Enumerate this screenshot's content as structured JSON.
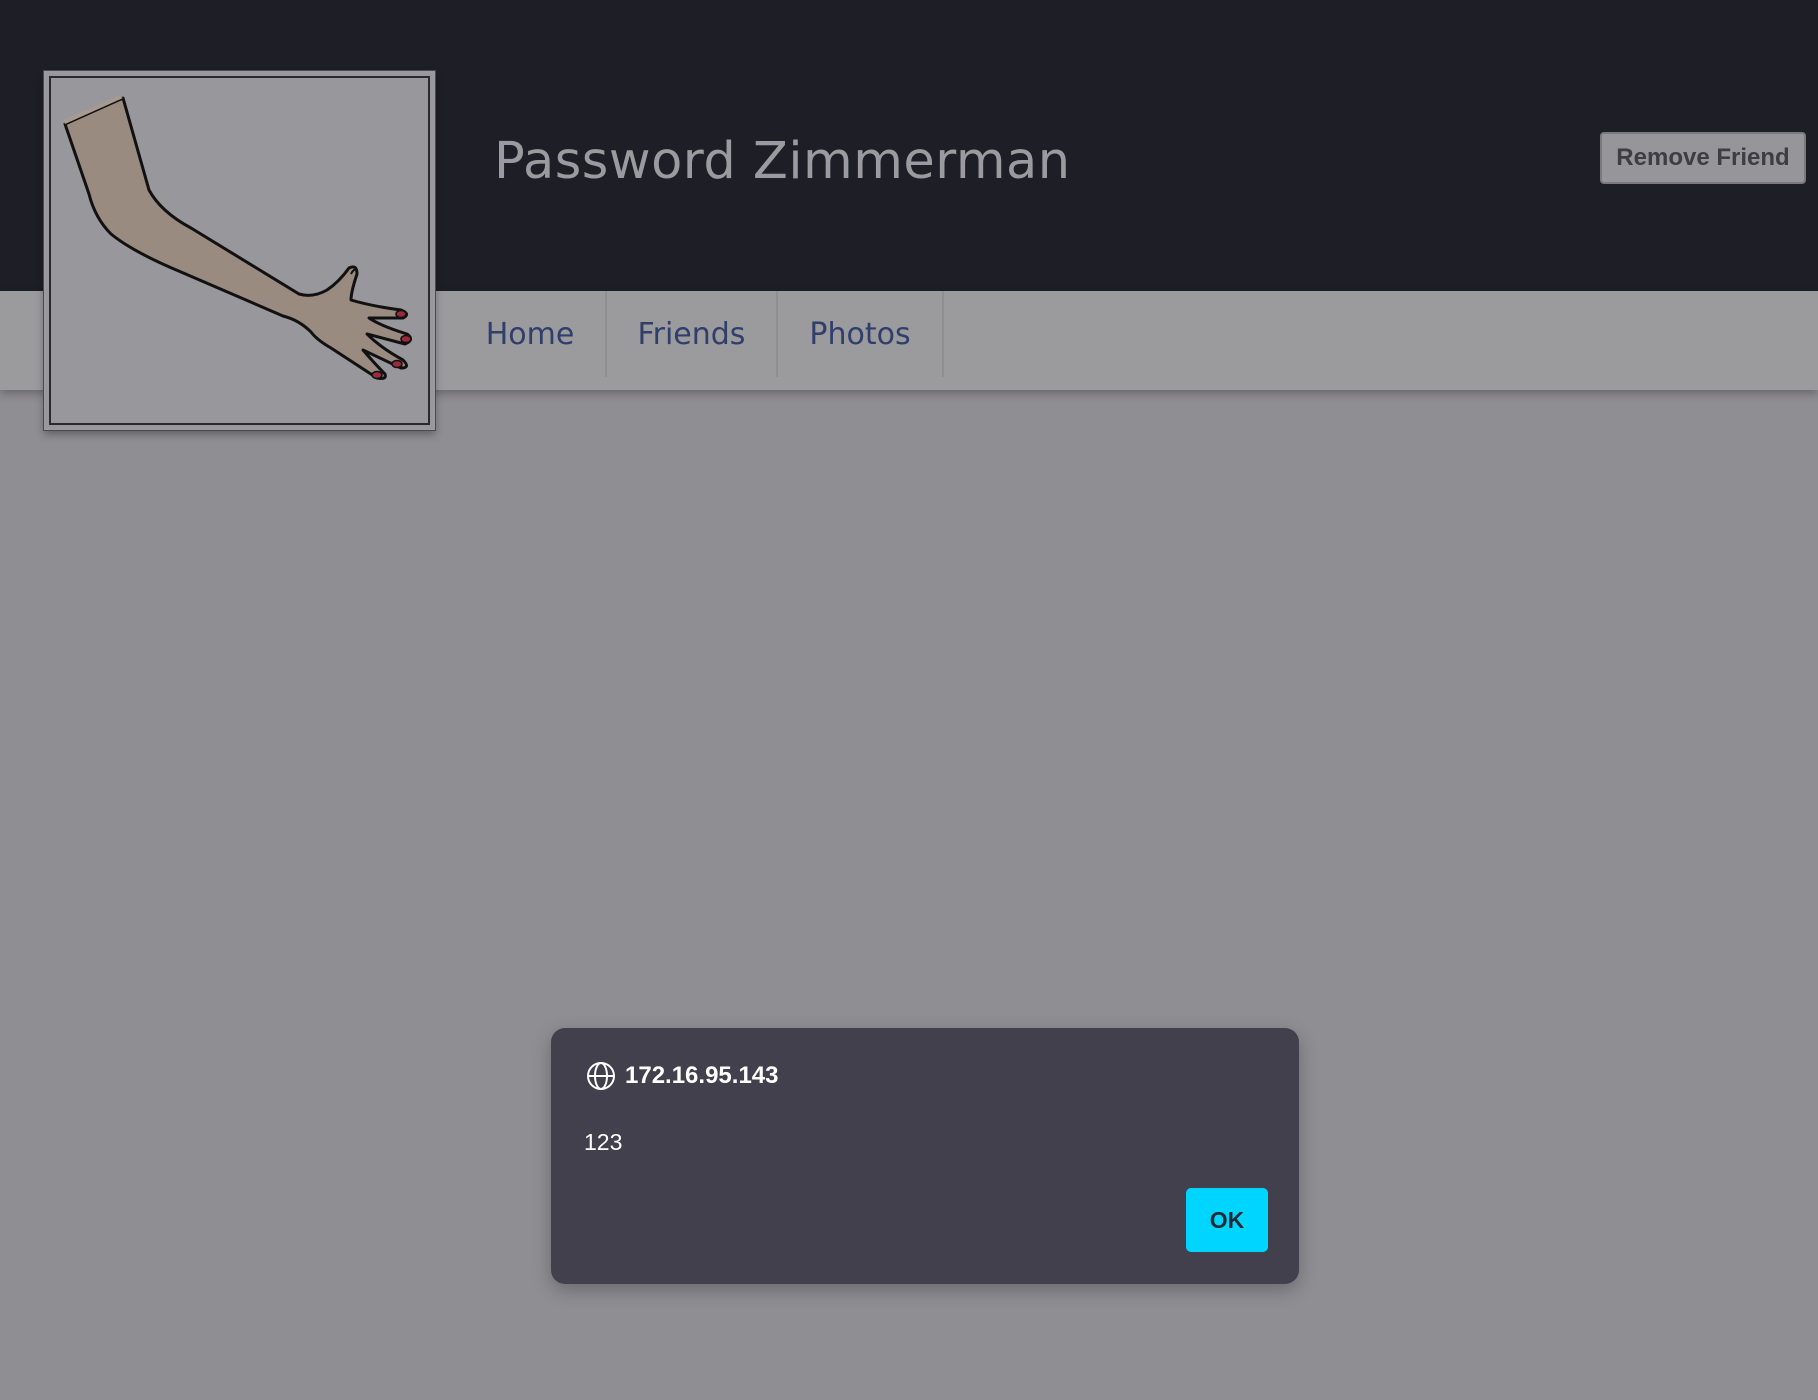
{
  "header": {
    "profile_name": "Password Zimmerman",
    "remove_friend_label": "Remove Friend"
  },
  "nav": {
    "items": [
      {
        "label": "Home"
      },
      {
        "label": "Friends"
      },
      {
        "label": "Photos"
      }
    ]
  },
  "avatar": {
    "icon": "arm-hand-drawing-icon"
  },
  "dialog": {
    "title": "172.16.95.143",
    "message": "123",
    "ok_label": "OK",
    "icon": "globe-icon"
  },
  "colors": {
    "header_bg": "#1e1e26",
    "overlay_bg": "#8f8e93",
    "nav_text": "#2f3e6a",
    "dialog_bg": "#42404c",
    "ok_button": "#00d5ff"
  }
}
